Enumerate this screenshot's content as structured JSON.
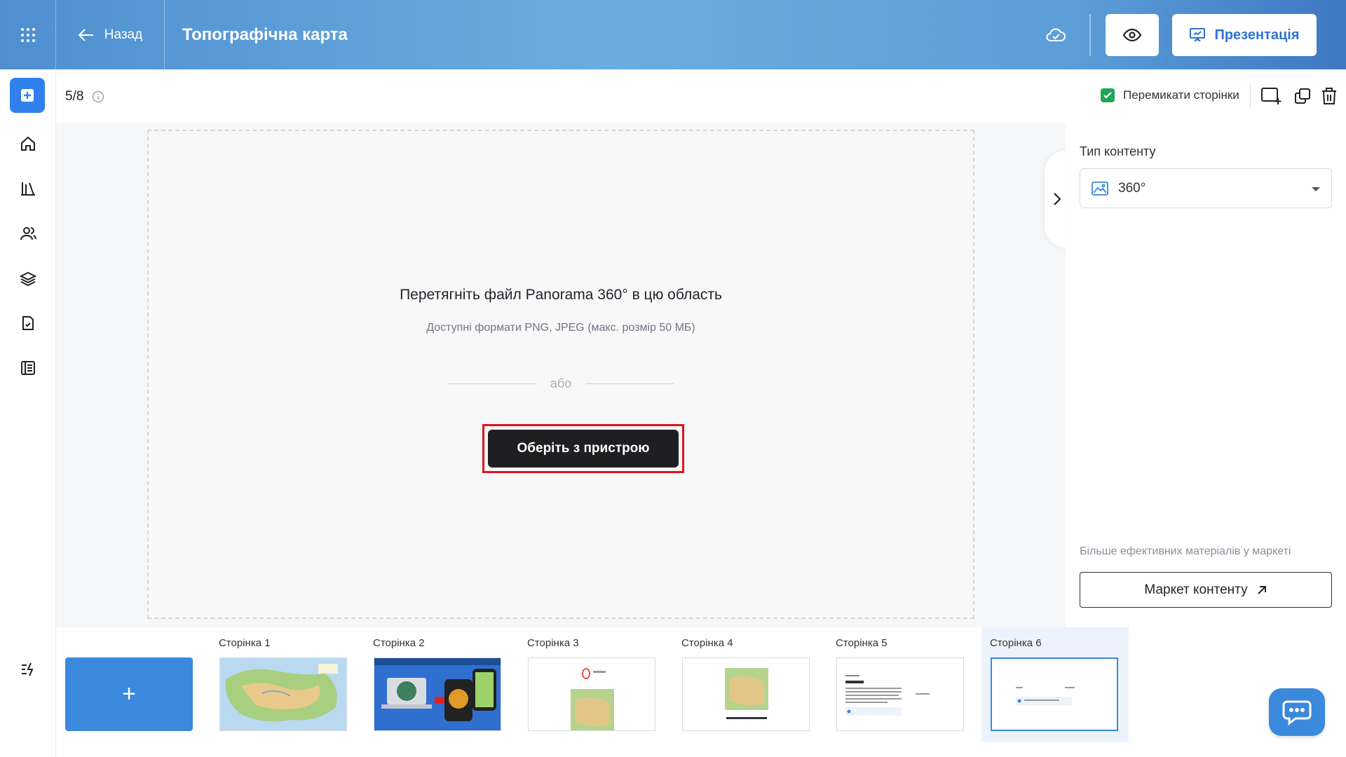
{
  "header": {
    "back_label": "Назад",
    "title": "Топографічна карта",
    "present_label": "Презентація",
    "icons": [
      "apps-grid-icon",
      "arrow-left-icon",
      "cloud-check-icon",
      "eye-icon",
      "presentation-icon"
    ]
  },
  "sidebar": {
    "items": [
      "add-icon",
      "home-icon",
      "library-icon",
      "users-icon",
      "courses-icon",
      "tasks-icon",
      "journal-icon",
      "activity-icon"
    ]
  },
  "toolbar": {
    "page_counter": "5/8",
    "switch_pages_label": "Перемикати сторінки",
    "switch_pages_checked": true
  },
  "dropzone": {
    "title": "Перетягніть файл Panorama 360° в цю область",
    "subtitle": "Доступні формати PNG, JPEG (макс. розмір 50 МБ)",
    "or_label": "або",
    "choose_button": "Оберіть з пристрою"
  },
  "right_panel": {
    "content_type_label": "Тип контенту",
    "content_type_value": "360°",
    "market_hint": "Більше ефективних матеріалів у маркеті",
    "market_button": "Маркет контенту"
  },
  "pages": [
    {
      "label": "Сторінка 1",
      "preview": "map"
    },
    {
      "label": "Сторінка 2",
      "preview": "video"
    },
    {
      "label": "Сторінка 3",
      "preview": "image"
    },
    {
      "label": "Сторінка 4",
      "preview": "map-text"
    },
    {
      "label": "Сторінка 5",
      "preview": "text"
    },
    {
      "label": "Сторінка 6",
      "preview": "blank",
      "active": true
    }
  ],
  "add_page_label": "+",
  "colors": {
    "accent": "#2f80ed",
    "highlight_outline": "#e0141e",
    "checkbox": "#22a65a"
  }
}
